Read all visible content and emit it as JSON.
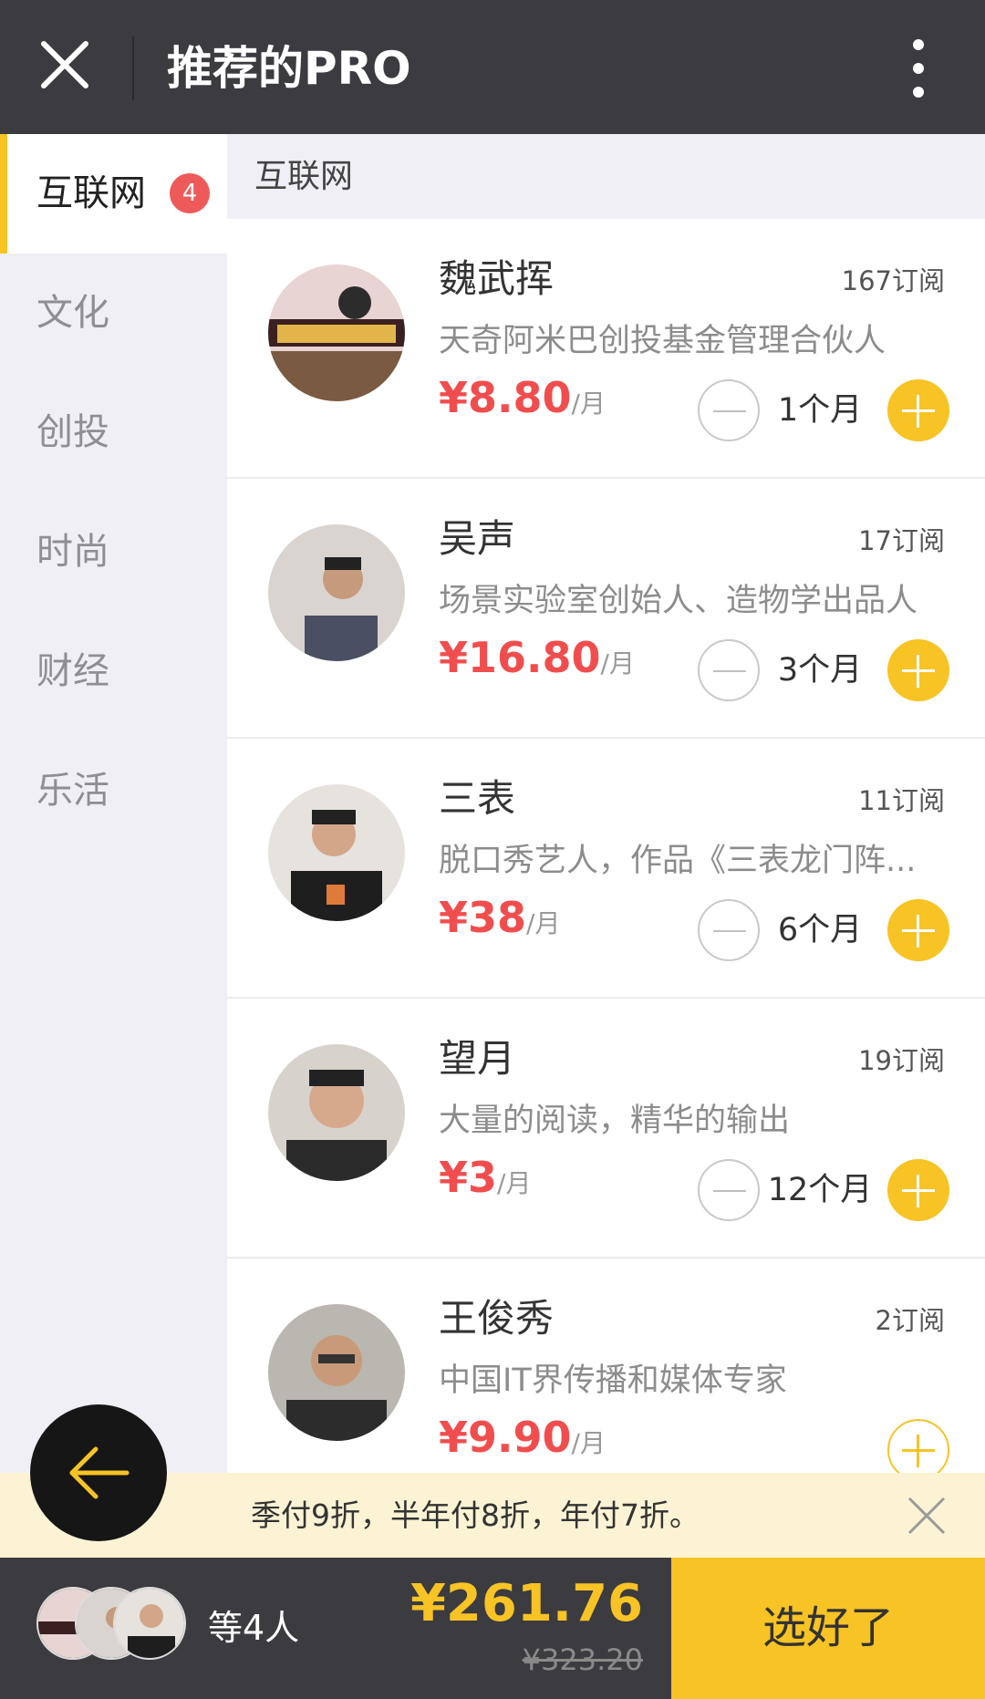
{
  "topbar": {
    "title": "推荐的PRO",
    "close_icon": "close-icon",
    "more_icon": "more-vertical-icon"
  },
  "sidebar": {
    "items": [
      {
        "label": "互联网",
        "badge": "4",
        "active": true
      },
      {
        "label": "文化"
      },
      {
        "label": "创投"
      },
      {
        "label": "时尚"
      },
      {
        "label": "财经"
      },
      {
        "label": "乐活"
      }
    ]
  },
  "main": {
    "category_header": "互联网",
    "cards": [
      {
        "name": "魏武挥",
        "subs": "167订阅",
        "desc": "天奇阿米巴创投基金管理合伙人",
        "price": "¥8.80",
        "unit": "/月",
        "duration": "1个月"
      },
      {
        "name": "吴声",
        "subs": "17订阅",
        "desc": "场景实验室创始人、造物学出品人",
        "price": "¥16.80",
        "unit": "/月",
        "duration": "3个月"
      },
      {
        "name": "三表",
        "subs": "11订阅",
        "desc": "脱口秀艺人，作品《三表龙门阵...",
        "price": "¥38",
        "unit": "/月",
        "duration": "6个月"
      },
      {
        "name": "望月",
        "subs": "19订阅",
        "desc": "大量的阅读，精华的输出",
        "price": "¥3",
        "unit": "/月",
        "duration": "12个月"
      },
      {
        "name": "王俊秀",
        "subs": "2订阅",
        "desc": "中国IT界传播和媒体专家",
        "price": "¥9.90",
        "unit": "/月"
      }
    ]
  },
  "notice": {
    "text": "季付9折，半年付8折，年付7折。"
  },
  "bottom": {
    "people": "等4人",
    "total": "¥261.76",
    "original": "¥323.20",
    "confirm": "选好了"
  },
  "colors": {
    "accent": "#f7c325",
    "price": "#f04e4e",
    "topbar": "#3b3b40",
    "sidebar_bg": "#f0eff5"
  }
}
